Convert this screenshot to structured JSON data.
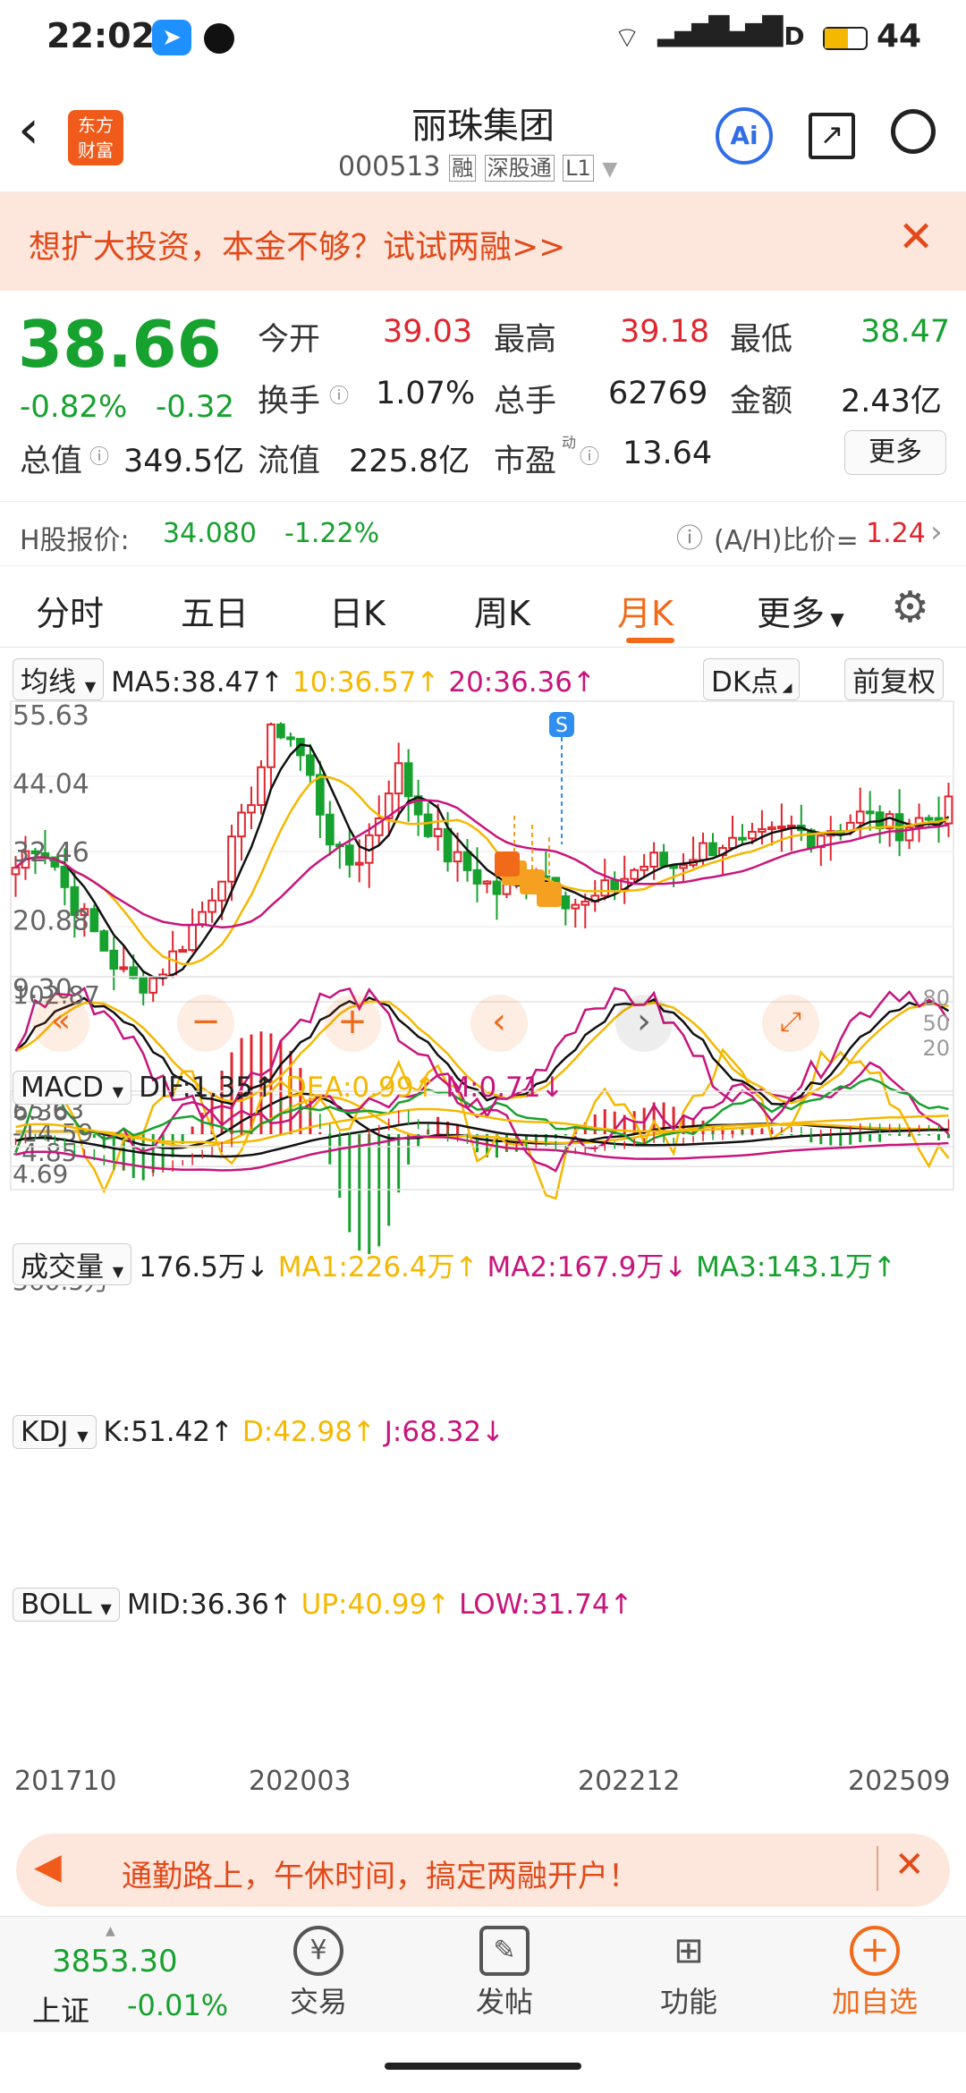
{
  "status": {
    "time": "22:02",
    "network": "4G",
    "hd": "HD",
    "battery": "44"
  },
  "header": {
    "title": "丽珠集团",
    "code": "000513",
    "tags": [
      "融",
      "深股通",
      "L1"
    ],
    "logo": "东方\n财富",
    "ai": "Ai"
  },
  "banner": {
    "text": "想扩大投资，本金不够？试试两融>>"
  },
  "quote": {
    "price": "38.66",
    "pct": "-0.82%",
    "chg": "-0.32",
    "r1": [
      {
        "l": "今开",
        "v": "39.03",
        "c": "red"
      },
      {
        "l": "最高",
        "v": "39.18",
        "c": "red"
      },
      {
        "l": "最低",
        "v": "38.47",
        "c": "green"
      }
    ],
    "r2": [
      {
        "l": "换手",
        "v": "1.07%"
      },
      {
        "l": "总手",
        "v": "62769"
      },
      {
        "l": "金额",
        "v": "2.43亿"
      }
    ],
    "r3": [
      {
        "l": "总值",
        "v": "349.5亿"
      },
      {
        "l": "流值",
        "v": "225.8亿"
      },
      {
        "l": "市盈",
        "sup": "动",
        "v": "13.64"
      }
    ],
    "more": "更多"
  },
  "hshare": {
    "label": "H股报价:",
    "price": "34.080",
    "pct": "-1.22%",
    "ratio_label": "(A/H)比价=",
    "ratio": "1.24"
  },
  "tabs": [
    "分时",
    "五日",
    "日K",
    "周K",
    "月K",
    "更多"
  ],
  "active_tab": 4,
  "ma": {
    "sel": "均线",
    "ma5": "MA5:38.47↑",
    "ma10": "10:36.57↑",
    "ma20": "20:36.36↑",
    "dk": "DK点",
    "fq": "前复权",
    "yticks": [
      "55.63",
      "44.04",
      "32.46",
      "20.88",
      "9.30"
    ],
    "badge": "S"
  },
  "macd": {
    "sel": "MACD",
    "dif": "DIF:1.35↑",
    "dea": "DEA:0.99↑",
    "m": "M:0.71↓",
    "yticks": [
      "6.36",
      "-4.85"
    ]
  },
  "vol": {
    "sel": "成交量",
    "v": "176.5万↓",
    "ma1": "MA1:226.4万↑",
    "ma2": "MA2:167.9万↓",
    "ma3": "MA3:143.1万↑",
    "ytick": "360.5万"
  },
  "kdj": {
    "sel": "KDJ",
    "k": "K:51.42↑",
    "d": "D:42.98↑",
    "j": "J:68.32↓",
    "yticks": [
      "102.87",
      "-14.59"
    ],
    "rticks": [
      "80",
      "50",
      "20"
    ]
  },
  "boll": {
    "sel": "BOLL",
    "mid": "MID:36.36↑",
    "up": "UP:40.99↑",
    "low": "LOW:31.74↑",
    "yticks": [
      "55.63",
      "4.69"
    ]
  },
  "xaxis": [
    "201710",
    "202003",
    "202212",
    "202509"
  ],
  "ad": {
    "text": "通勤路上，午休时间，搞定两融开户！"
  },
  "bottom": {
    "index_val": "3853.30",
    "index_name": "上证",
    "index_pct": "-0.01%",
    "nav": [
      "交易",
      "发帖",
      "功能",
      "加自选"
    ]
  },
  "colors": {
    "up": "#e0262f",
    "down": "#17a12f",
    "accent": "#f06a1a",
    "ma5": "#111",
    "ma10": "#f5b800",
    "ma20": "#c8157c"
  }
}
